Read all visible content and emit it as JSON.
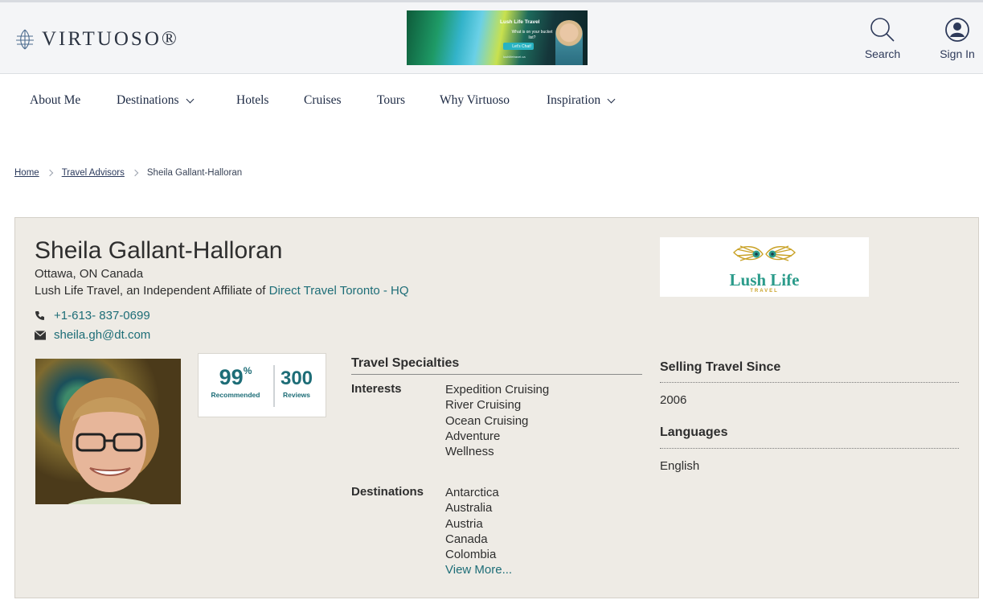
{
  "header": {
    "logo_text": "VIRTUOSO",
    "banner": {
      "title": "Lush Life Travel",
      "subtitle": "What is on your bucket list?",
      "cta": "Let's Chat!",
      "url": "lushlifetravel.ca"
    },
    "search_label": "Search",
    "signin_label": "Sign In"
  },
  "nav": {
    "items": [
      "About Me",
      "Destinations",
      "Hotels",
      "Cruises",
      "Tours",
      "Why Virtuoso",
      "Inspiration"
    ]
  },
  "breadcrumb": {
    "home": "Home",
    "advisors": "Travel Advisors",
    "current": "Sheila Gallant-Halloran"
  },
  "advisor": {
    "name": "Sheila Gallant-Halloran",
    "location": "Ottawa, ON Canada",
    "affiliation_prefix": "Lush Life Travel, an Independent Affiliate of ",
    "affiliation_link": "Direct Travel Toronto - HQ",
    "phone": "+1-613- 837-0699",
    "email": "sheila.gh@dt.com",
    "company_logo": {
      "name": "Lush Life",
      "sub": "TRAVEL"
    },
    "recommended_pct": "99",
    "recommended_suffix": "%",
    "recommended_label": "Recommended",
    "reviews_count": "300",
    "reviews_label": "Reviews"
  },
  "specialties": {
    "title": "Travel Specialties",
    "interests_label": "Interests",
    "interests": [
      "Expedition Cruising",
      "River Cruising",
      "Ocean Cruising",
      "Adventure",
      "Wellness"
    ],
    "destinations_label": "Destinations",
    "destinations": [
      "Antarctica",
      "Australia",
      "Austria",
      "Canada",
      "Colombia"
    ],
    "view_more": "View More..."
  },
  "selling": {
    "title": "Selling Travel Since",
    "value": "2006"
  },
  "languages": {
    "title": "Languages",
    "value": "English"
  },
  "colors": {
    "accent_teal": "#1d6d77",
    "card_bg": "#eeebe5",
    "nav_text": "#1d2a44"
  }
}
